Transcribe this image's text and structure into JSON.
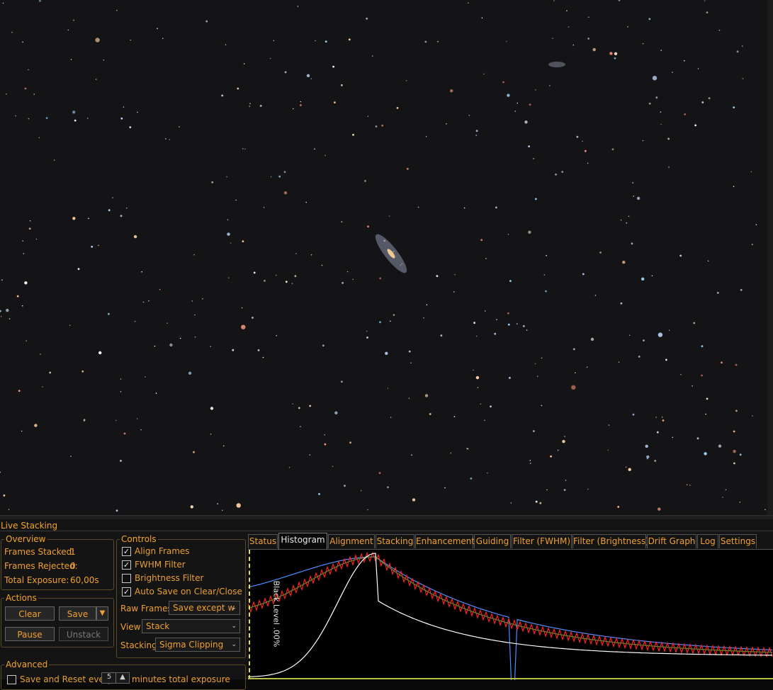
{
  "panel": {
    "title": "Live Stacking",
    "overview": {
      "legend": "Overview",
      "frames_stacked_label": "Frames Stacked:",
      "frames_stacked_value": "1",
      "frames_rejected_label": "Frames Rejected:",
      "frames_rejected_value": "0",
      "total_exposure_label": "Total Exposure:",
      "total_exposure_value": "60,00s"
    },
    "actions": {
      "legend": "Actions",
      "clear": "Clear",
      "save": "Save",
      "pause": "Pause",
      "unstack": "Unstack"
    },
    "controls": {
      "legend": "Controls",
      "checkboxes": [
        {
          "label": "Align Frames",
          "checked": true
        },
        {
          "label": "FWHM Filter",
          "checked": true
        },
        {
          "label": "Brightness Filter",
          "checked": false
        },
        {
          "label": "Auto Save on Clear/Close",
          "checked": true
        }
      ],
      "raw_frames_label": "Raw Frames",
      "raw_frames_value": "Save except w",
      "view_label": "View",
      "view_value": "Stack",
      "stacking_label": "Stacking",
      "stacking_value": "Sigma Clipping"
    },
    "advanced": {
      "legend": "Advanced",
      "save_reset_prefix": "Save and Reset every",
      "save_reset_value": "5",
      "save_reset_suffix": "minutes total exposure"
    },
    "tabs": [
      {
        "label": "Status",
        "active": false
      },
      {
        "label": "Histogram",
        "active": true
      },
      {
        "label": "Alignment",
        "active": false
      },
      {
        "label": "Stacking",
        "active": false
      },
      {
        "label": "Enhancement",
        "active": false
      },
      {
        "label": "Guiding",
        "active": false
      },
      {
        "label": "Filter (FWHM)",
        "active": false
      },
      {
        "label": "Filter (Brightness)",
        "active": false
      },
      {
        "label": "Drift Graph",
        "active": false
      },
      {
        "label": "Log",
        "active": false
      },
      {
        "label": "Settings",
        "active": false
      }
    ],
    "histogram": {
      "black_level_label": "Black Level .00%",
      "colors": {
        "white": "#ffffff",
        "blue": "#4a90ff",
        "green": "#2faa2f",
        "red": "#ff2020",
        "black_level": "#e8e040"
      }
    }
  }
}
